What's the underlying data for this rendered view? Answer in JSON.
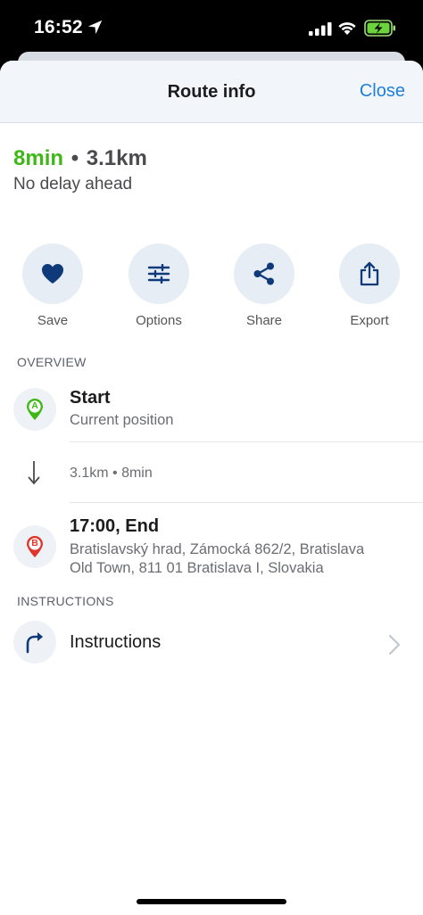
{
  "status_bar": {
    "time": "16:52"
  },
  "header": {
    "title": "Route info",
    "close_label": "Close"
  },
  "summary": {
    "duration": "8min",
    "separator": "•",
    "distance": "3.1km",
    "delay_text": "No delay ahead"
  },
  "actions": [
    {
      "label": "Save",
      "icon": "heart-icon"
    },
    {
      "label": "Options",
      "icon": "sliders-icon"
    },
    {
      "label": "Share",
      "icon": "share-icon"
    },
    {
      "label": "Export",
      "icon": "export-icon"
    }
  ],
  "overview": {
    "section_label": "OVERVIEW",
    "start": {
      "title": "Start",
      "subtitle": "Current position",
      "marker": "A"
    },
    "leg": {
      "text": "3.1km • 8min"
    },
    "end": {
      "title": "17:00, End",
      "address_line1": "Bratislavský hrad, Zámocká 862/2, Bratislava",
      "address_line2": "Old Town, 811 01 Bratislava I, Slovakia",
      "marker": "B"
    }
  },
  "instructions": {
    "section_label": "INSTRUCTIONS",
    "item_label": "Instructions"
  },
  "colors": {
    "accent_blue": "#1f7fd9",
    "duration_green": "#3db817",
    "icon_navy": "#0f3a7a",
    "marker_a_green": "#3db817",
    "marker_b_red": "#e0352b"
  }
}
